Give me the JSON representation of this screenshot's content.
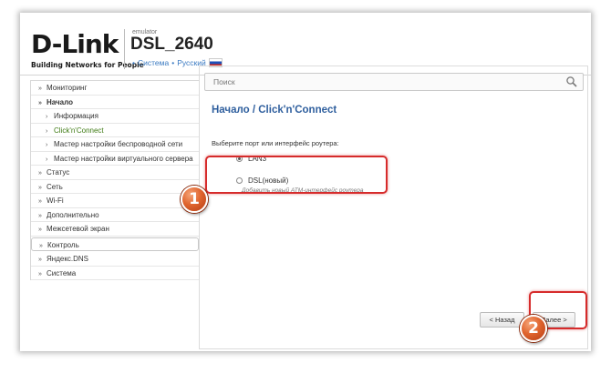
{
  "header": {
    "logo": "D-Link",
    "tagline": "Building Networks for People",
    "emulator_label": "emulator",
    "model": "DSL_2640",
    "crumb_system": "Система",
    "crumb_lang": "Русский",
    "crumb_separator": "•"
  },
  "sidebar": {
    "items": [
      {
        "label": "Мониторинг"
      },
      {
        "label": "Начало"
      },
      {
        "label": "Информация"
      },
      {
        "label": "Click'n'Connect"
      },
      {
        "label": "Мастер настройки беспроводной сети"
      },
      {
        "label": "Мастер настройки виртуального сервера"
      },
      {
        "label": "Статус"
      },
      {
        "label": "Сеть"
      },
      {
        "label": "Wi-Fi"
      },
      {
        "label": "Дополнительно"
      },
      {
        "label": "Межсетевой экран"
      },
      {
        "label": "Контроль"
      },
      {
        "label": "Яндекс.DNS"
      },
      {
        "label": "Система"
      }
    ]
  },
  "search": {
    "placeholder": "Поиск"
  },
  "page": {
    "title": "Начало /  Click'n'Connect",
    "caption": "Выберите порт или интерфейс роутера:",
    "option_lan": "LAN3",
    "option_dsl": "DSL(новый)",
    "option_dsl_desc": "Добавить новый ATM-интерфейс роутера"
  },
  "buttons": {
    "back": "< Назад",
    "next": "Далее >"
  },
  "annotations": {
    "badge1": "1",
    "badge2": "2"
  },
  "colors": {
    "accent": "#2f5f9e",
    "highlight": "#d62b2b",
    "badge": "#e0652f",
    "active_menu": "#3d7a12"
  },
  "icons": {
    "search": "magnifier-icon",
    "flag": "russian-flag-icon"
  }
}
